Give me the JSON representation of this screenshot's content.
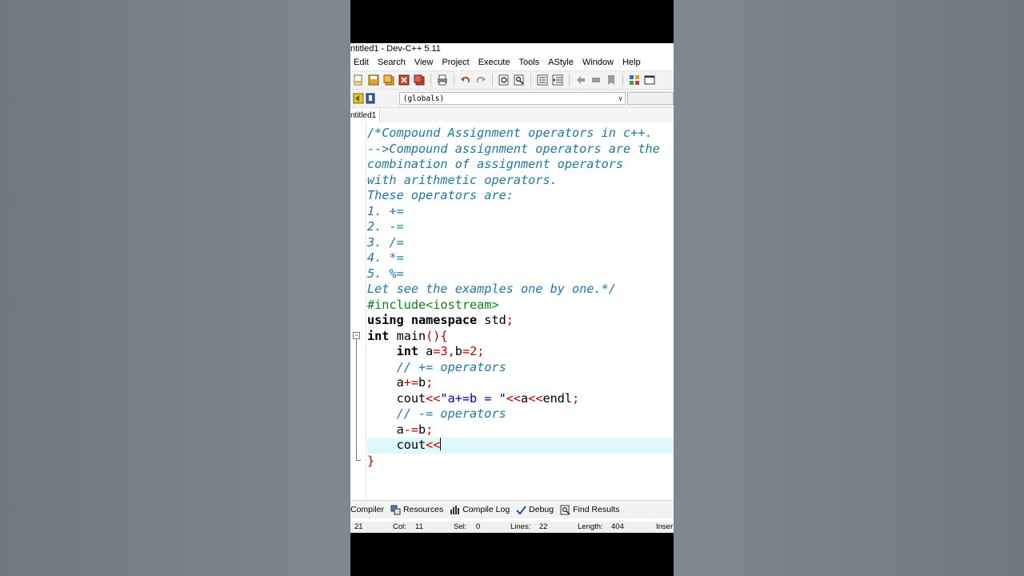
{
  "window": {
    "title": "ntitled1 - Dev-C++ 5.11"
  },
  "menu": [
    "Edit",
    "Search",
    "View",
    "Project",
    "Execute",
    "Tools",
    "AStyle",
    "Window",
    "Help"
  ],
  "scope_combo": {
    "value": "(globals)"
  },
  "tab": {
    "label": "ntitled1"
  },
  "code_lines": [
    [
      {
        "t": "/*Compound Assignment operators in c++.",
        "k": "c"
      }
    ],
    [
      {
        "t": "-->Compound assignment operators are the",
        "k": "c"
      }
    ],
    [
      {
        "t": "combination of assignment operators",
        "k": "c"
      }
    ],
    [
      {
        "t": "with arithmetic operators.",
        "k": "c"
      }
    ],
    [
      {
        "t": "These operators are:",
        "k": "c"
      }
    ],
    [
      {
        "t": "1. +=",
        "k": "c"
      }
    ],
    [
      {
        "t": "2. -=",
        "k": "c"
      }
    ],
    [
      {
        "t": "3. /=",
        "k": "c"
      }
    ],
    [
      {
        "t": "4. *=",
        "k": "c"
      }
    ],
    [
      {
        "t": "5. %=",
        "k": "c"
      }
    ],
    [
      {
        "t": "Let see the examples one by one.*/",
        "k": "c"
      }
    ],
    [
      {
        "t": "#include<iostream>",
        "k": "pp"
      }
    ],
    [
      {
        "t": "using namespace",
        "k": "kw"
      },
      {
        "t": " std",
        "k": "id"
      },
      {
        "t": ";",
        "k": "op"
      }
    ],
    [
      {
        "t": "int",
        "k": "kw"
      },
      {
        "t": " main",
        "k": "id"
      },
      {
        "t": "(){",
        "k": "op"
      }
    ],
    [
      {
        "t": "    ",
        "k": "id"
      },
      {
        "t": "int",
        "k": "kw"
      },
      {
        "t": " a",
        "k": "id"
      },
      {
        "t": "=",
        "k": "op"
      },
      {
        "t": "3",
        "k": "num"
      },
      {
        "t": ",",
        "k": "op"
      },
      {
        "t": "b",
        "k": "id"
      },
      {
        "t": "=",
        "k": "op"
      },
      {
        "t": "2",
        "k": "num"
      },
      {
        "t": ";",
        "k": "op"
      }
    ],
    [
      {
        "t": "    // += operators",
        "k": "c"
      }
    ],
    [
      {
        "t": "    a",
        "k": "id"
      },
      {
        "t": "+=",
        "k": "op"
      },
      {
        "t": "b",
        "k": "id"
      },
      {
        "t": ";",
        "k": "op"
      }
    ],
    [
      {
        "t": "    cout",
        "k": "id"
      },
      {
        "t": "<<",
        "k": "op"
      },
      {
        "t": "\"a+=b = \"",
        "k": "str"
      },
      {
        "t": "<<",
        "k": "op"
      },
      {
        "t": "a",
        "k": "id"
      },
      {
        "t": "<<",
        "k": "op"
      },
      {
        "t": "endl",
        "k": "id"
      },
      {
        "t": ";",
        "k": "op"
      }
    ],
    [
      {
        "t": "    // -= operators",
        "k": "c"
      }
    ],
    [
      {
        "t": "    a",
        "k": "id"
      },
      {
        "t": "-=",
        "k": "op"
      },
      {
        "t": "b",
        "k": "id"
      },
      {
        "t": ";",
        "k": "op"
      }
    ],
    [
      {
        "t": "    cout",
        "k": "id"
      },
      {
        "t": "<<",
        "k": "op"
      },
      {
        "t": "",
        "k": "caret"
      }
    ],
    [
      {
        "t": "}",
        "k": "op"
      }
    ]
  ],
  "current_line_index": 20,
  "bottom_tabs": {
    "compiler": "Compiler",
    "resources": "Resources",
    "compile_log": "Compile Log",
    "debug": "Debug",
    "find_results": "Find Results"
  },
  "status": {
    "line": "21",
    "col_label": "Col:",
    "col": "11",
    "sel_label": "Sel:",
    "sel": "0",
    "lines_label": "Lines:",
    "lines": "22",
    "length_label": "Length:",
    "length": "404",
    "mode": "Inser"
  },
  "colors": {
    "comment": "#1f77a8",
    "preprocessor": "#128012",
    "operator": "#c00000",
    "string": "#0000a0",
    "current_line": "#dff8fb"
  }
}
